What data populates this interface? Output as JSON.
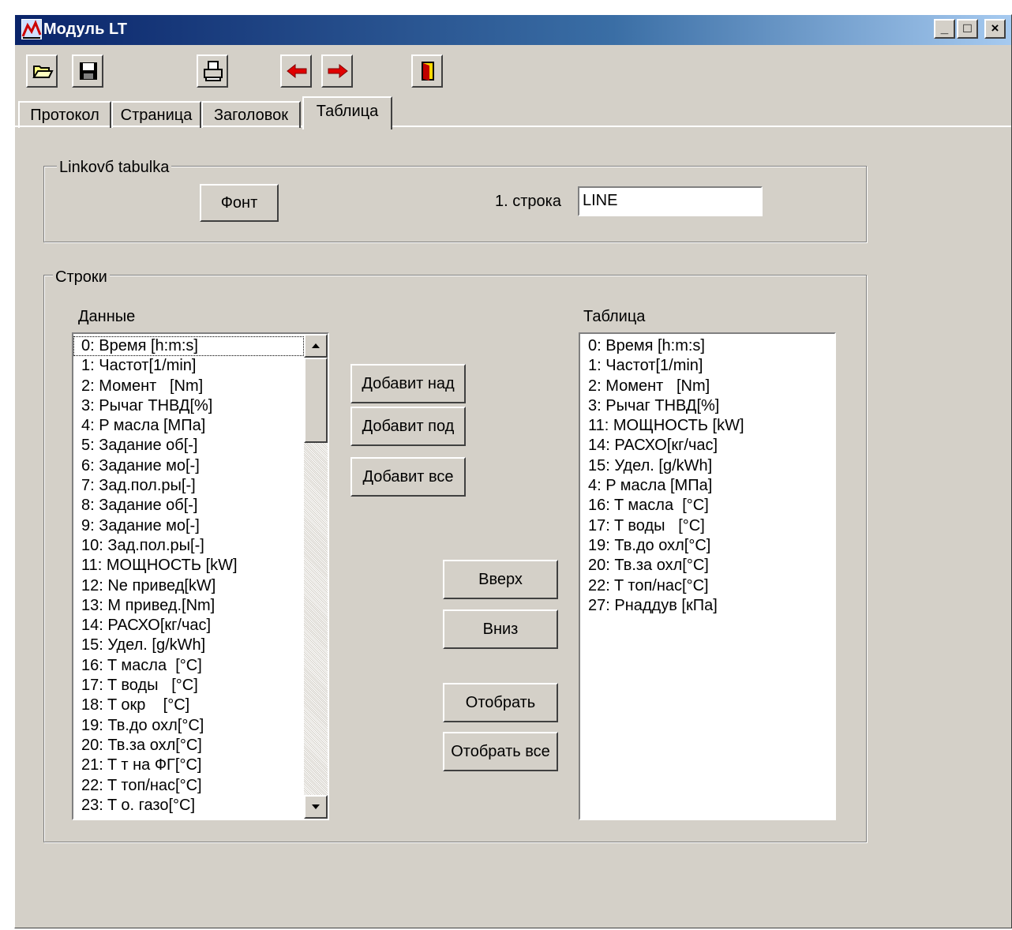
{
  "window": {
    "title": "Модуль LT",
    "minimize_glyph": "_",
    "maximize_glyph": "□",
    "close_glyph": "×"
  },
  "toolbar": {
    "buttons": [
      {
        "name": "open-folder-icon"
      },
      {
        "name": "save-icon"
      },
      {
        "name": "print-icon"
      },
      {
        "name": "arrow-left-icon"
      },
      {
        "name": "arrow-right-icon"
      },
      {
        "name": "exit-door-icon"
      }
    ]
  },
  "tabs": [
    {
      "label": "Протокол",
      "active": false
    },
    {
      "label": "Страница",
      "active": false
    },
    {
      "label": "Заголовок",
      "active": false
    },
    {
      "label": "Таблица",
      "active": true
    }
  ],
  "linkovy": {
    "legend": "Linkovб tabulka",
    "font_button": "Фонт",
    "first_row_label": "1. строка",
    "first_row_value": "LINE"
  },
  "rows_group": {
    "legend": "Строки",
    "data_label": "Данные",
    "table_label": "Таблица",
    "data_items": [
      "0: Время [h:m:s]",
      "1: Частот[1/min]",
      "2: Момент   [Nm]",
      "3: Рычаг ТНВД[%]",
      "4: P масла [МПа]",
      "5: Задание об[-]",
      "6: Задание мо[-]",
      "7: Зад.пол.ры[-]",
      "8: Задание об[-]",
      "9: Задание мо[-]",
      "10: Зад.пол.ры[-]",
      "11: МОЩНОСТЬ [kW]",
      "12: Ne привед[kW]",
      "13: M привед.[Nm]",
      "14: РАСХО[кг/час]",
      "15: Удел. [g/kWh]",
      "16: T масла  [°C]",
      "17: T воды   [°C]",
      "18: T окр    [°C]",
      "19: Тв.до охл[°C]",
      "20: Тв.за охл[°C]",
      "21: T т на ФГ[°C]",
      "22: T топ/нас[°C]",
      "23: T о. газо[°C]"
    ],
    "table_items": [
      "0: Время [h:m:s]",
      "1: Частот[1/min]",
      "2: Момент   [Nm]",
      "3: Рычаг ТНВД[%]",
      "11: МОЩНОСТЬ [kW]",
      "14: РАСХО[кг/час]",
      "15: Удел. [g/kWh]",
      "4: P масла [МПа]",
      "16: T масла  [°C]",
      "17: T воды   [°C]",
      "19: Тв.до охл[°C]",
      "20: Тв.за охл[°C]",
      "22: T топ/нас[°C]",
      "27: Рнаддув [кПа]"
    ],
    "add_above": "Добавит над",
    "add_below": "Добавит под",
    "add_all": "Добавит все",
    "up": "Вверх",
    "down": "Вниз",
    "select": "Отобрать",
    "select_all": "Отобрать все"
  }
}
